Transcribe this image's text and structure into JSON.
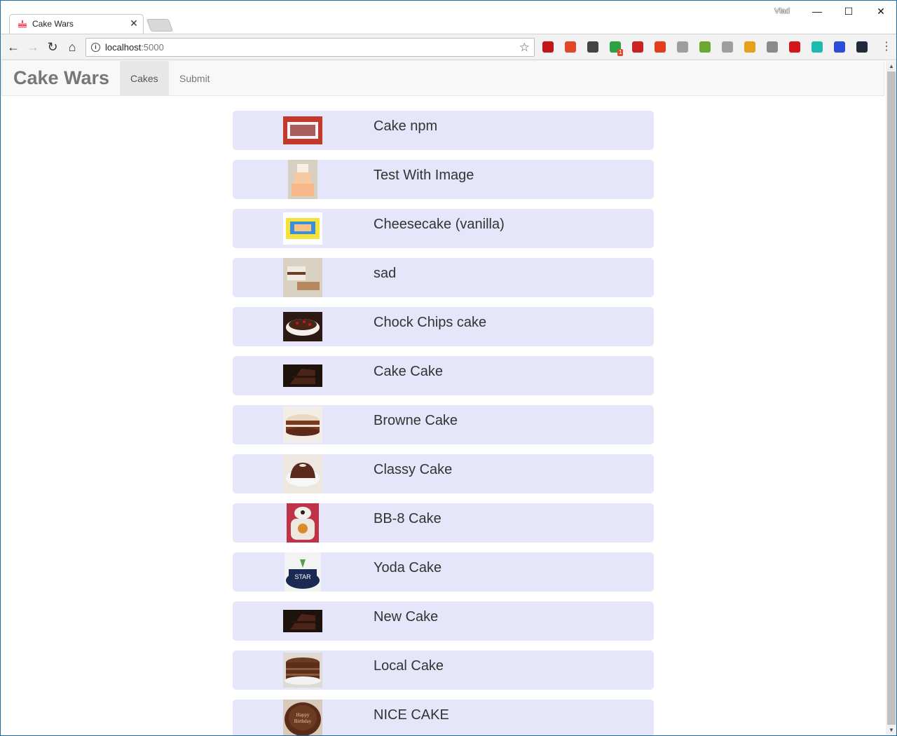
{
  "browser": {
    "tab_title": "Cake Wars",
    "profile_name": "Vlad",
    "url_host": "localhost",
    "url_port": ":5000",
    "extensions": [
      {
        "name": "adblock-plus-icon",
        "color": "#c3161c"
      },
      {
        "name": "extension-icon",
        "color": "#e2452a"
      },
      {
        "name": "pocket-icon",
        "color": "#444444"
      },
      {
        "name": "extension-icon",
        "color": "#2ba245"
      },
      {
        "name": "lastpass-icon",
        "color": "#cc2027"
      },
      {
        "name": "extension-icon",
        "color": "#e43d1e"
      },
      {
        "name": "extension-icon",
        "color": "#9e9e9e"
      },
      {
        "name": "extension-icon",
        "color": "#6aa830"
      },
      {
        "name": "extension-icon",
        "color": "#9e9e9e"
      },
      {
        "name": "extension-icon",
        "color": "#e6a01c"
      },
      {
        "name": "camera-icon",
        "color": "#8a8a8a"
      },
      {
        "name": "extension-icon",
        "color": "#d4161c"
      },
      {
        "name": "extension-icon",
        "color": "#1cbab0"
      },
      {
        "name": "extension-icon",
        "color": "#2e4cd8"
      },
      {
        "name": "react-devtools-icon",
        "color": "#222b3a"
      }
    ],
    "extension_badge": "1"
  },
  "navbar": {
    "brand": "Cake Wars",
    "links": [
      {
        "label": "Cakes",
        "active": true
      },
      {
        "label": "Submit",
        "active": false
      }
    ]
  },
  "cakes": [
    {
      "name": "Cake npm",
      "thumb": "sign"
    },
    {
      "name": "Test With Image",
      "thumb": "tiered"
    },
    {
      "name": "Cheesecake (vanilla)",
      "thumb": "sheet"
    },
    {
      "name": "sad",
      "thumb": "slice"
    },
    {
      "name": "Chock Chips cake",
      "thumb": "forest"
    },
    {
      "name": "Cake Cake",
      "thumb": "dark-slice"
    },
    {
      "name": "Browne Cake",
      "thumb": "layer"
    },
    {
      "name": "Classy Cake",
      "thumb": "bundt"
    },
    {
      "name": "BB-8 Cake",
      "thumb": "bb8"
    },
    {
      "name": "Yoda Cake",
      "thumb": "starwars"
    },
    {
      "name": "New Cake",
      "thumb": "dark-slice"
    },
    {
      "name": "Local Cake",
      "thumb": "choc-layer"
    },
    {
      "name": "NICE CAKE",
      "thumb": "birthday"
    }
  ]
}
